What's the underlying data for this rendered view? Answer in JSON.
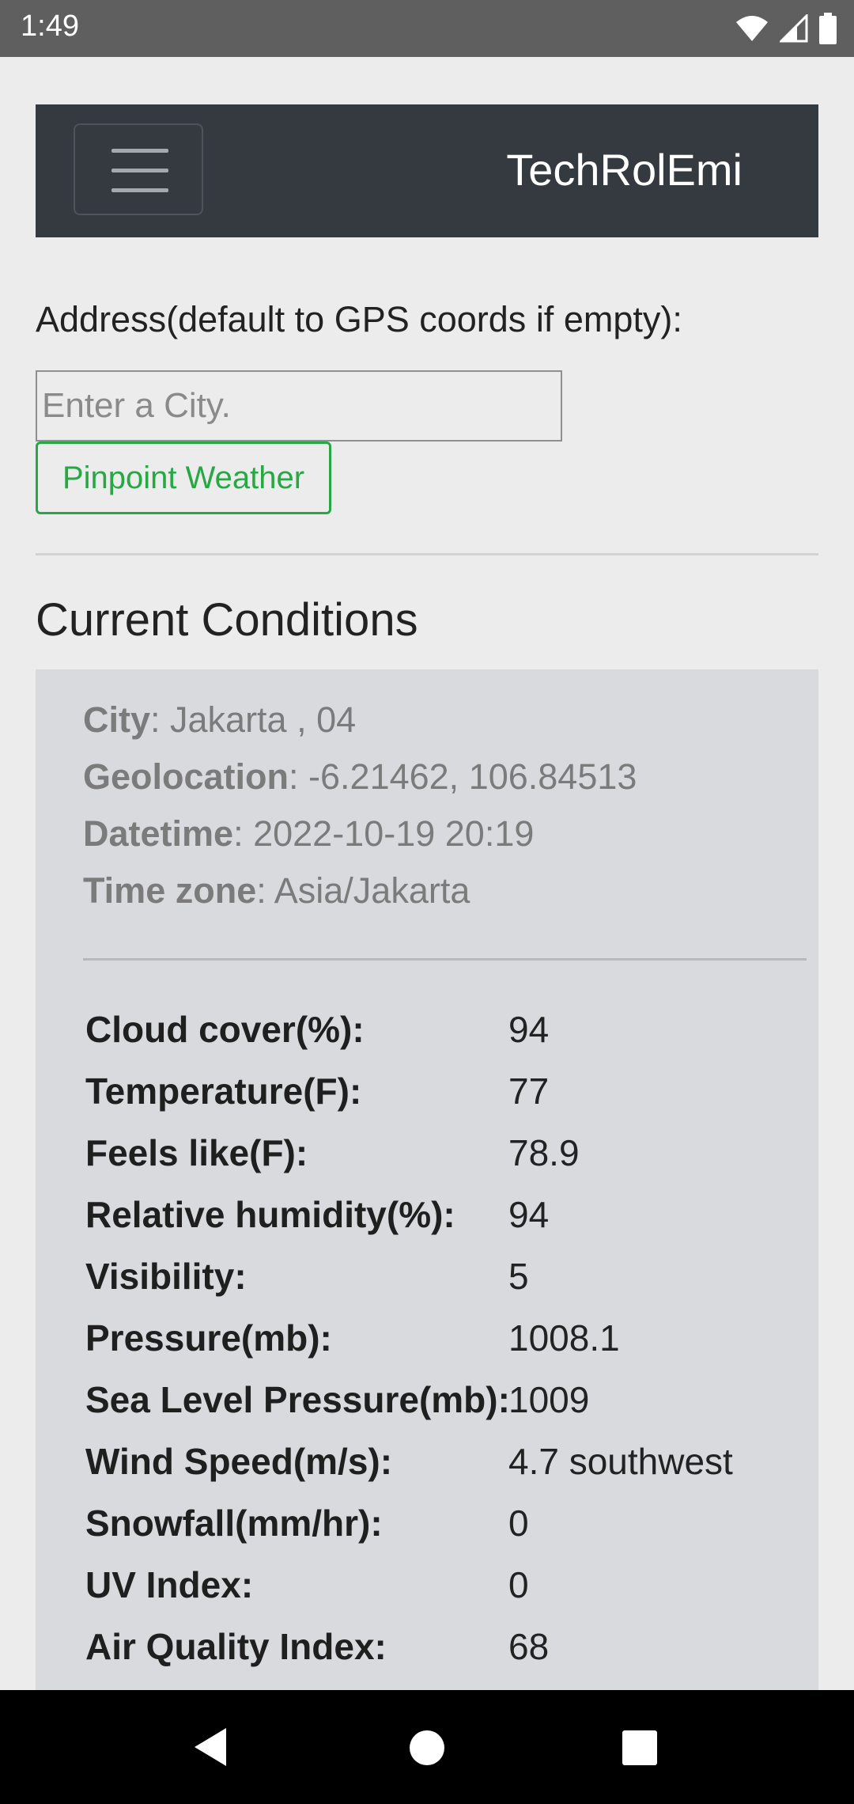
{
  "status_bar": {
    "time": "1:49"
  },
  "navbar": {
    "brand": "TechRolEmi"
  },
  "form": {
    "address_label": "Address(default to GPS coords if empty):",
    "city_placeholder": "Enter a City.",
    "city_value": "",
    "button_label": "Pinpoint Weather"
  },
  "conditions": {
    "title": "Current Conditions",
    "info": [
      {
        "label": "City",
        "value": ": Jakarta , 04"
      },
      {
        "label": "Geolocation",
        "value": ": -6.21462, 106.84513"
      },
      {
        "label": "Datetime",
        "value": ": 2022-10-19 20:19"
      },
      {
        "label": "Time zone",
        "value": ": Asia/Jakarta"
      }
    ],
    "rows": [
      {
        "label": "Cloud cover(%):",
        "value": "94"
      },
      {
        "label": "Temperature(F):",
        "value": "77"
      },
      {
        "label": "Feels like(F):",
        "value": "78.9"
      },
      {
        "label": "Relative humidity(%):",
        "value": "94"
      },
      {
        "label": "Visibility:",
        "value": "5"
      },
      {
        "label": "Pressure(mb):",
        "value": "1008.1"
      },
      {
        "label": "Sea Level Pressure(mb):",
        "value": "1009"
      },
      {
        "label": "Wind Speed(m/s):",
        "value": "4.7 southwest"
      },
      {
        "label": "Snowfall(mm/hr):",
        "value": "0"
      },
      {
        "label": "UV Index:",
        "value": "0"
      },
      {
        "label": "Air Quality Index:",
        "value": "68"
      }
    ]
  }
}
